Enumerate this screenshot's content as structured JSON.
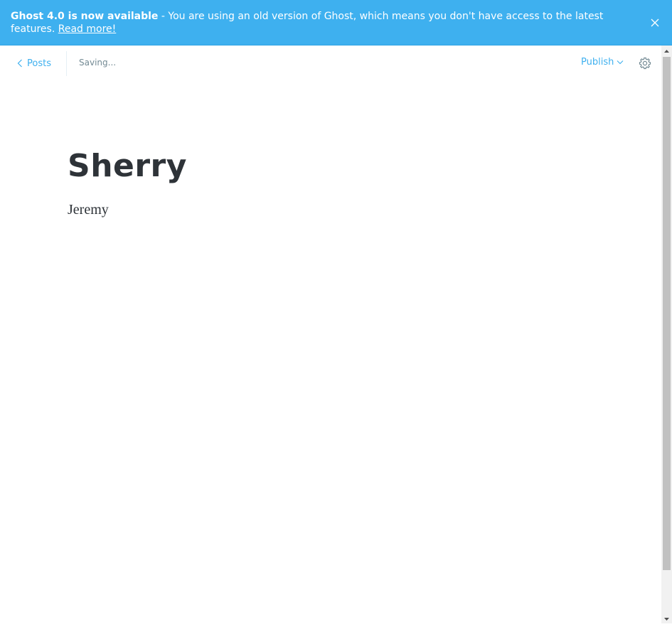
{
  "banner": {
    "headline": "Ghost 4.0 is now available",
    "message": " - You are using an old version of Ghost, which means you don't have access to the latest features. ",
    "link_label": "Read more!",
    "close_icon": "close-icon"
  },
  "header": {
    "back_label": "Posts",
    "back_icon": "chevron-left-icon",
    "status": "Saving...",
    "publish_label": "Publish",
    "publish_icon": "chevron-down-icon",
    "settings_icon": "gear-icon"
  },
  "post": {
    "title": "Sherry",
    "body": "Jeremy"
  },
  "colors": {
    "accent": "#3eb0ef",
    "text": "#2e3338",
    "muted": "#738a94"
  }
}
